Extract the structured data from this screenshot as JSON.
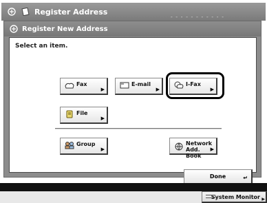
{
  "window": {
    "title": "Register Address",
    "ghost_text": "- - - - - - -   - - - -"
  },
  "dialog": {
    "title": "Register New Address",
    "prompt": "Select an item."
  },
  "buttons": {
    "fax": "Fax",
    "email": "E-mail",
    "ifax": "I-Fax",
    "file": "File",
    "group": "Group",
    "network_line1": "Network",
    "network_line2": "Add. Book",
    "done": "Done"
  },
  "selected_item": "I-Fax",
  "system_monitor": "System Monitor",
  "colors": {
    "title_bar": "#8a8a8a",
    "panel_bg": "#ffffff",
    "selection_ring": "#000000"
  }
}
